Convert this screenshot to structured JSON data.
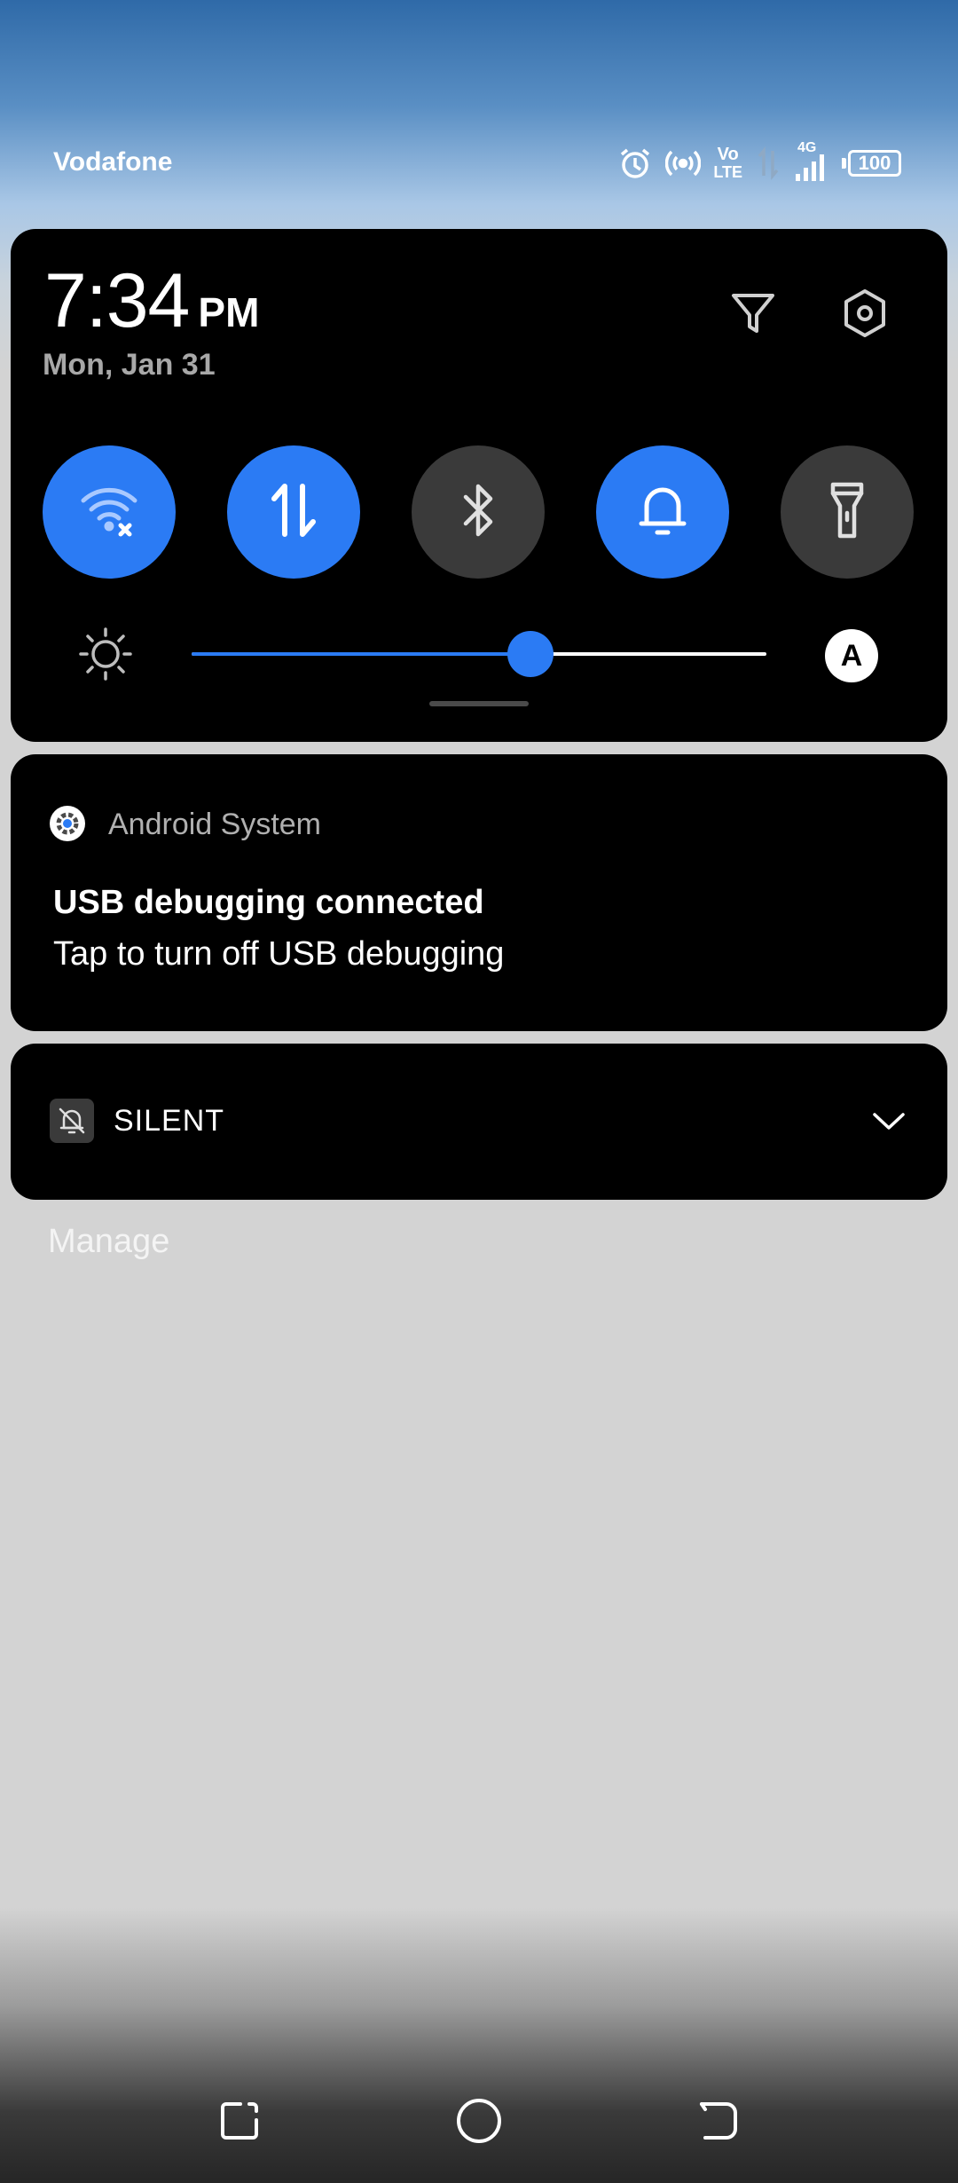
{
  "status_bar": {
    "carrier": "Vodafone",
    "icons": [
      "alarm-icon",
      "hotspot-icon",
      "volte-icon",
      "data-arrows-icon",
      "signal-4g-icon"
    ],
    "volte_top": "Vo",
    "volte_bottom": "LTE",
    "network": "4G",
    "battery": "100"
  },
  "quick_settings": {
    "time": "7:34",
    "ampm": "PM",
    "date": "Mon, Jan 31",
    "top_icons": [
      "filter-icon",
      "settings-icon"
    ],
    "tiles": [
      {
        "name": "wifi",
        "icon": "wifi-off-icon",
        "on": true
      },
      {
        "name": "mobile-data",
        "icon": "data-arrows-icon",
        "on": true
      },
      {
        "name": "bluetooth",
        "icon": "bluetooth-icon",
        "on": false
      },
      {
        "name": "sound",
        "icon": "bell-icon",
        "on": true
      },
      {
        "name": "flashlight",
        "icon": "flashlight-icon",
        "on": false
      }
    ],
    "brightness_level": 0.59,
    "auto_brightness_label": "A"
  },
  "notification": {
    "app_name": "Android System",
    "title": "USB debugging connected",
    "text": "Tap to turn off USB debugging"
  },
  "silent_section": {
    "label": "SILENT"
  },
  "manage_label": "Manage",
  "nav_bar": [
    "recents-icon",
    "home-icon",
    "back-icon"
  ],
  "colors": {
    "accent": "#2b7bf4",
    "tile_off": "#3a3a3a",
    "panel": "#000000"
  }
}
